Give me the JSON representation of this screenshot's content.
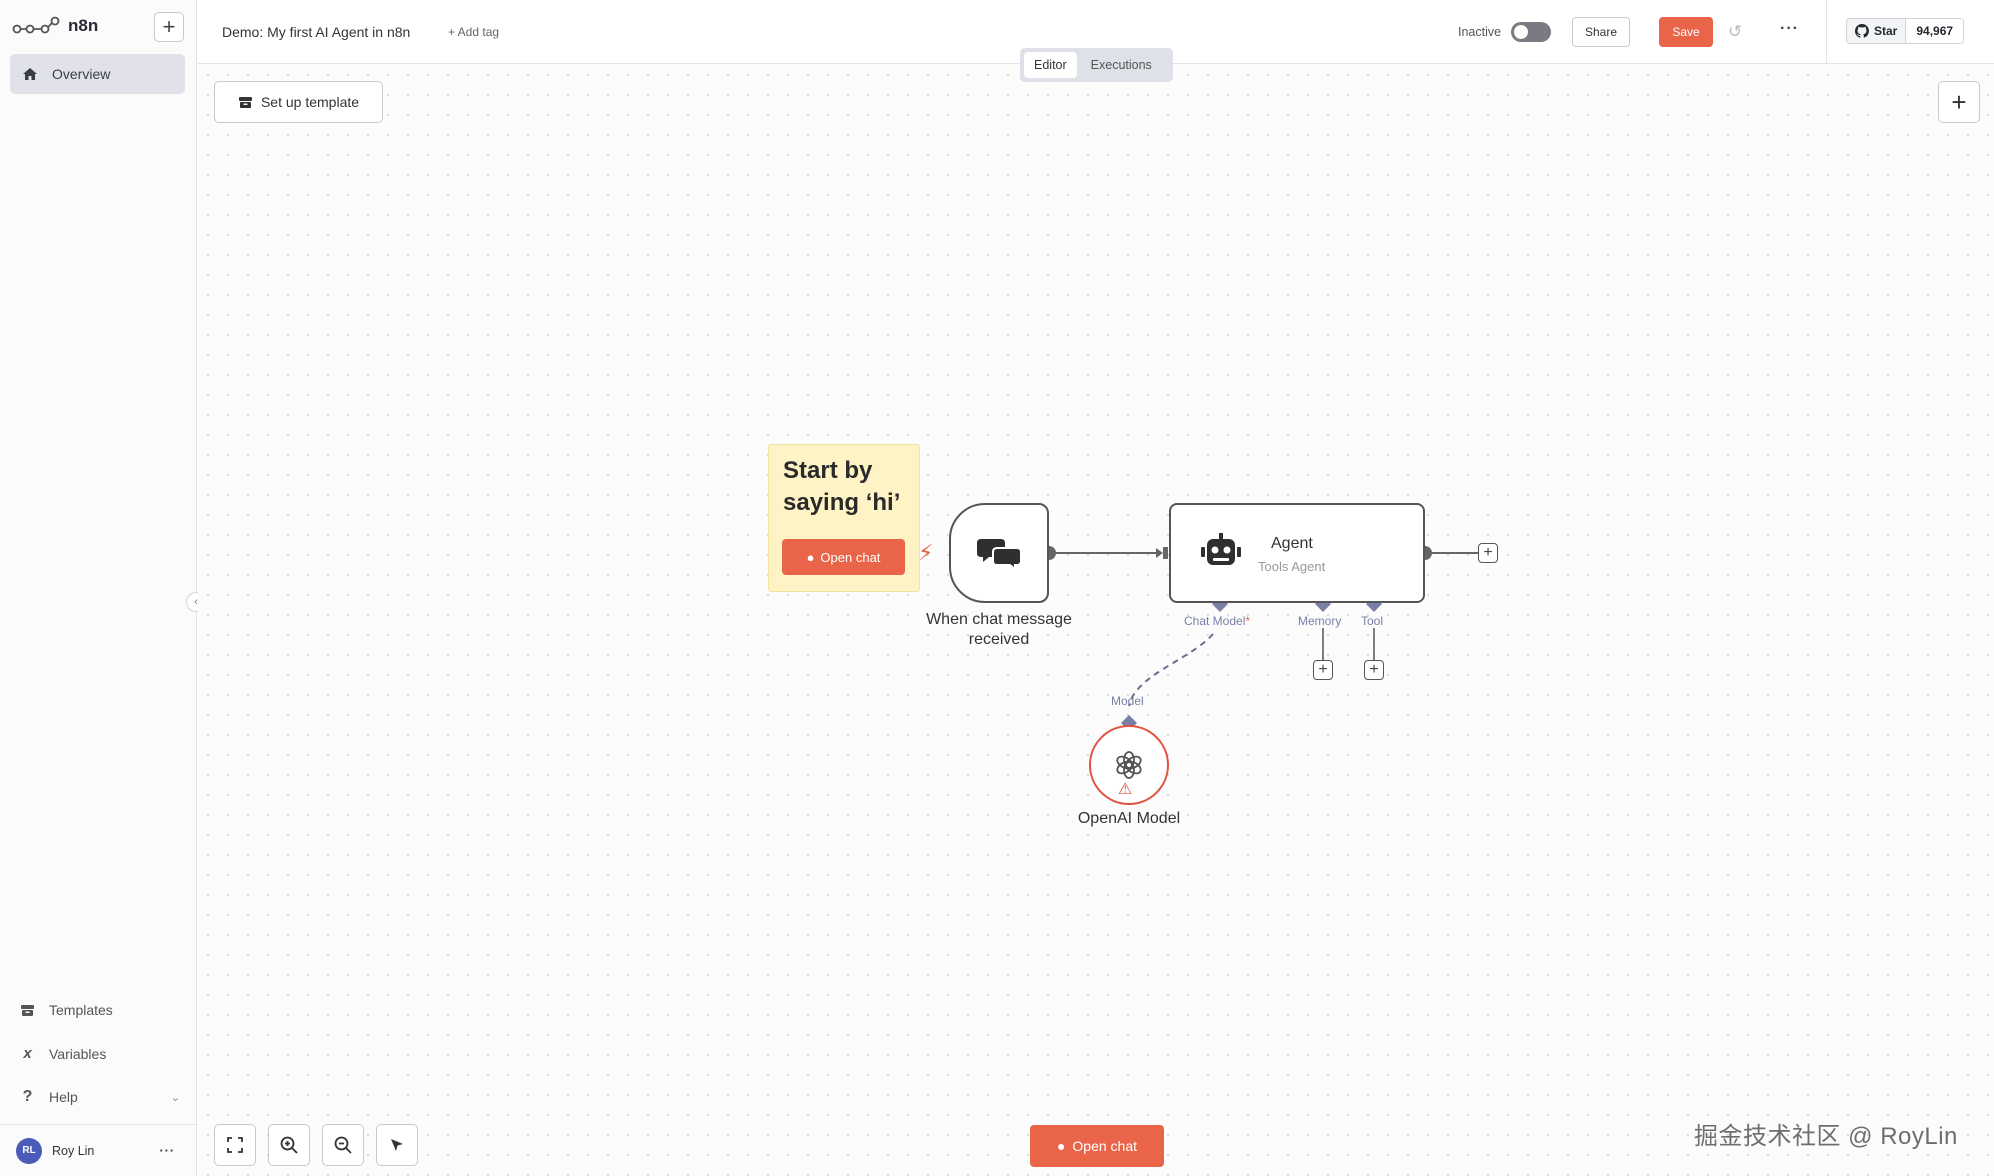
{
  "brand": {
    "name": "n8n"
  },
  "sidebar": {
    "overview_label": "Overview",
    "bottom_items": [
      {
        "label": "Templates",
        "icon": "box-icon"
      },
      {
        "label": "Variables",
        "icon": "variable-icon"
      },
      {
        "label": "Help",
        "icon": "question-icon"
      }
    ],
    "user": {
      "initials": "RL",
      "name": "Roy Lin"
    }
  },
  "header": {
    "workflow_name": "Demo: My first AI Agent in n8n",
    "add_tag": "+ Add tag",
    "status_label": "Inactive",
    "share_label": "Share",
    "save_label": "Save",
    "github": {
      "star_label": "Star",
      "star_count": "94,967"
    }
  },
  "tabs": {
    "editor": "Editor",
    "executions": "Executions"
  },
  "canvas": {
    "setup_template_label": "Set up template",
    "sticky": {
      "title": "Start by saying ‘hi’",
      "button_label": "Open chat"
    },
    "trigger_node": {
      "label": "When chat message received"
    },
    "agent_node": {
      "title": "Agent",
      "subtitle": "Tools Agent"
    },
    "ports": {
      "chat_model": "Chat Model",
      "required_mark": "*",
      "memory": "Memory",
      "tool": "Tool",
      "model": "Model"
    },
    "model_node": {
      "label": "OpenAI Model"
    },
    "open_chat_label": "Open chat"
  },
  "watermark": "掘金技术社区 @ RoyLin",
  "colors": {
    "accent": "#ea6449",
    "connector": "#7a7fa8",
    "error": "#e0513f"
  }
}
